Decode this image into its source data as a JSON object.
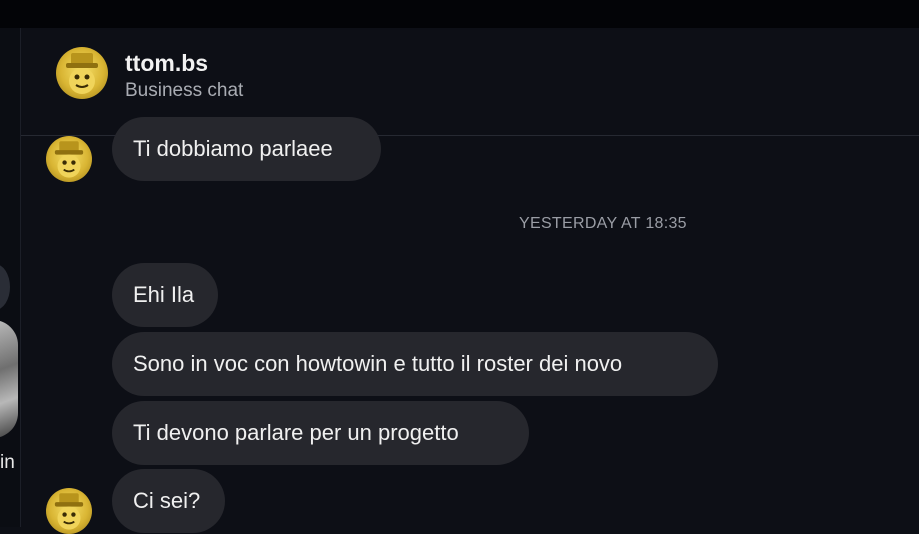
{
  "window": {
    "left_partial_text": "in"
  },
  "header": {
    "username": "ttom.bs",
    "subtitle": "Business chat"
  },
  "messages": {
    "first": "Ti dobbiamo parlaee",
    "timestamp": "YESTERDAY AT 18:35",
    "items": [
      "Ehi Ila",
      "Sono in voc con howtowin e tutto il roster dei novo",
      "Ti devono parlare per un progetto",
      "Ci sei?"
    ]
  },
  "colors": {
    "background": "#0d0f16",
    "bubble": "#26272d",
    "avatar_gold": "#d9b533"
  },
  "icons": {
    "avatar": "gold-mascot-avatar"
  }
}
